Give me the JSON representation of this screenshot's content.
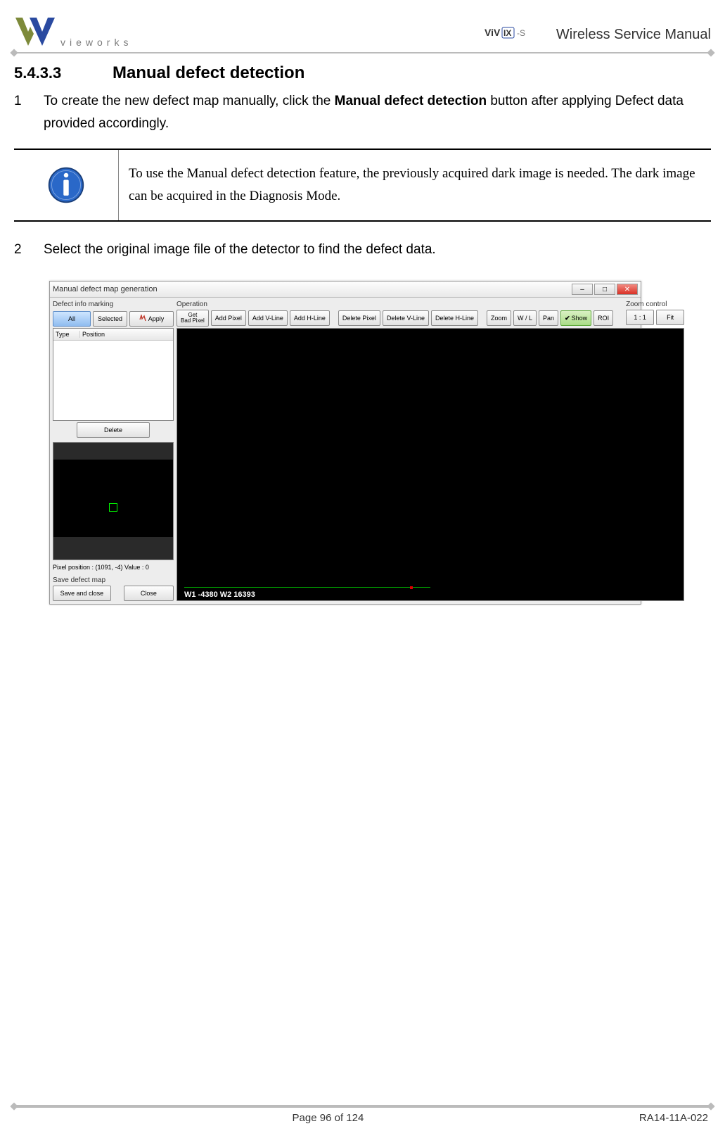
{
  "header": {
    "logo_text": "vieworks",
    "product_logo": "ViVIX -S",
    "doc_title": "Wireless Service Manual"
  },
  "section": {
    "number": "5.4.3.3",
    "title": "Manual defect detection"
  },
  "steps": {
    "s1_num": "1",
    "s1_a": "To create the new defect map manually, click the ",
    "s1_bold": "Manual defect detection",
    "s1_b": " button after applying Defect data provided accordingly.",
    "s2_num": "2",
    "s2": "Select the original image file of the detector to find the defect data."
  },
  "info": {
    "text": "To use the Manual defect detection feature, the previously acquired dark image is needed. The dark image can be acquired in the Diagnosis Mode."
  },
  "app": {
    "title": "Manual defect map generation",
    "left": {
      "marking_label": "Defect info marking",
      "all": "All",
      "selected": "Selected",
      "apply": "Apply",
      "col_type": "Type",
      "col_position": "Position",
      "delete": "Delete",
      "status": "Pixel position :    (1091, -4)    Value : 0",
      "save_label": "Save defect map",
      "save_close": "Save and close",
      "close": "Close"
    },
    "toolbar": {
      "operation_label": "Operation",
      "get_bad_top": "Get",
      "get_bad_bot": "Bad Pixel",
      "add_pixel": "Add Pixel",
      "add_vline": "Add V-Line",
      "add_hline": "Add H-Line",
      "delete_pixel": "Delete Pixel",
      "delete_vline": "Delete V-Line",
      "delete_hline": "Delete H-Line",
      "zoom": "Zoom",
      "wl": "W / L",
      "pan": "Pan",
      "show": "Show",
      "roi": "ROI",
      "zoom_control_label": "Zoom control",
      "one_one": "1 : 1",
      "fit": "Fit"
    },
    "viewer": {
      "readout": "W1 -4380  W2 16393"
    },
    "win": {
      "min": "–",
      "max": "□",
      "close": "✕"
    }
  },
  "footer": {
    "page": "Page 96 of 124",
    "doc_id": "RA14-11A-022"
  }
}
